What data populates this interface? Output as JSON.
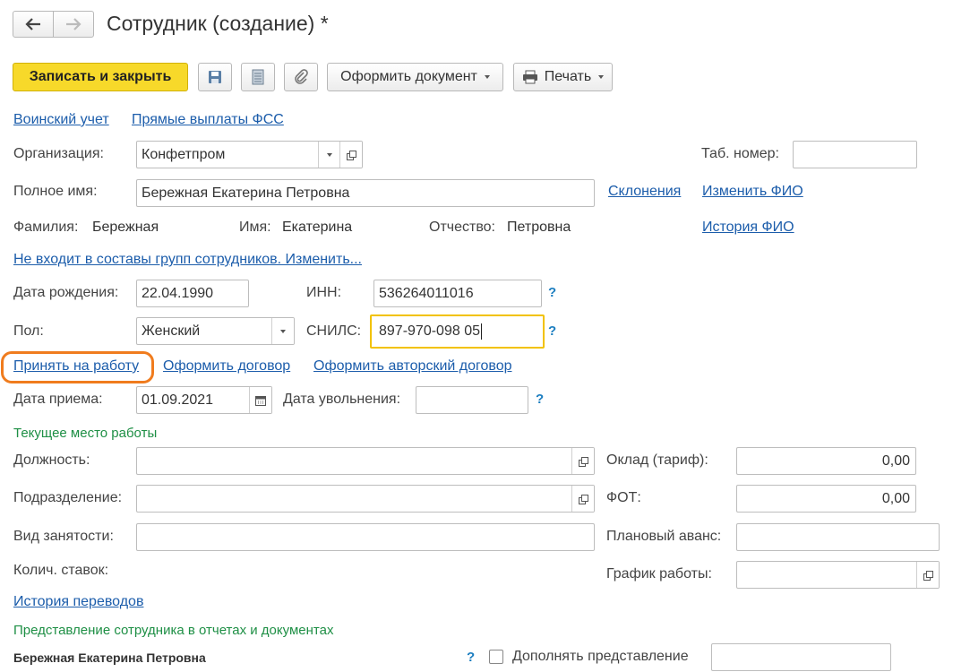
{
  "header": {
    "title": "Сотрудник (создание) *",
    "back_icon": "arrow-left-icon",
    "forward_icon": "arrow-right-icon"
  },
  "toolbar": {
    "save_close_label": "Записать и закрыть",
    "save_icon": "floppy-icon",
    "list_icon": "document-list-icon",
    "attach_icon": "paperclip-icon",
    "create_doc_label": "Оформить документ",
    "print_label": "Печать",
    "print_icon": "printer-icon"
  },
  "top_links": {
    "military": "Воинский учет",
    "fss": "Прямые выплаты ФСС"
  },
  "org": {
    "label": "Организация:",
    "value": "Конфетпром",
    "tab_label": "Таб. номер:",
    "tab_value": ""
  },
  "fullname": {
    "label": "Полное имя:",
    "value": "Бережная Екатерина Петровна",
    "declensions_link": "Склонения",
    "change_fio_link": "Изменить ФИО"
  },
  "name_parts": {
    "surname_label": "Фамилия:",
    "surname_value": "Бережная",
    "name_label": "Имя:",
    "name_value": "Екатерина",
    "patronymic_label": "Отчество:",
    "patronymic_value": "Петровна",
    "history_link": "История ФИО"
  },
  "groups_link": "Не входит в составы групп сотрудников. Изменить...",
  "birth": {
    "label": "Дата рождения:",
    "value": "22.04.1990",
    "inn_label": "ИНН:",
    "inn_value": "536264011016",
    "help": "?"
  },
  "gender": {
    "label": "Пол:",
    "value": "Женский",
    "snils_label": "СНИЛС:",
    "snils_value": "897-970-098 05",
    "help": "?"
  },
  "actions": {
    "hire": "Принять на работу",
    "contract": "Оформить договор",
    "author_contract": "Оформить авторский договор"
  },
  "dates": {
    "hire_label": "Дата приема:",
    "hire_value": "01.09.2021",
    "dismiss_label": "Дата увольнения:",
    "dismiss_value": " .  .",
    "help": "?"
  },
  "current_work": {
    "section_title": "Текущее место работы",
    "position_label": "Должность:",
    "position_value": "",
    "salary_label": "Оклад (тариф):",
    "salary_value": "0,00",
    "department_label": "Подразделение:",
    "department_value": "",
    "fot_label": "ФОТ:",
    "fot_value": "0,00",
    "employment_label": "Вид занятости:",
    "employment_value": "",
    "advance_label": "Плановый аванс:",
    "advance_value": "",
    "rates_label": "Колич. ставок:",
    "schedule_label": "График работы:",
    "schedule_value": ""
  },
  "transfers_link": "История переводов",
  "representation": {
    "section_title": "Представление сотрудника в отчетах и документах",
    "value": "Бережная Екатерина Петровна",
    "help": "?",
    "extend_label": "Дополнять представление",
    "extend_checked": false,
    "extend_value": ""
  },
  "colors": {
    "accent_yellow": "#f7d92a",
    "link_blue": "#1c5dab",
    "section_green": "#1e8f45",
    "highlight_orange": "#f07c1e"
  }
}
